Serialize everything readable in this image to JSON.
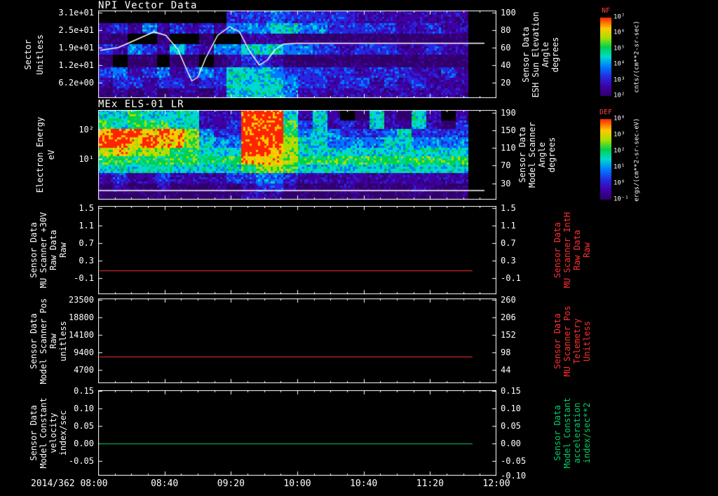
{
  "chart_data": {
    "type": "multi-panel time series (2 spectrograms + 3 line plots)",
    "time_axis": {
      "date": "2014/362",
      "start": "08:00",
      "end": "12:00",
      "start_label": "2014/362 08:00",
      "tick_labels": [
        "08:40",
        "09:20",
        "10:00",
        "10:40",
        "11:20",
        "12:00"
      ]
    },
    "intensity_scale": "grid values 0-9 mapped to rainbow colormap (0=black, 2=purple-blue, 5=cyan, 6=green, 9=red)",
    "panels": [
      {
        "type": "spectrogram",
        "title": "NPI Vector Data",
        "left_title": [
          "Sector",
          "Unitless"
        ],
        "left_ticks": [
          "3.1e+01",
          "2.5e+01",
          "1.9e+01",
          "1.2e+01",
          "6.2e+00"
        ],
        "right_title": [
          "Sensor Data",
          "ESH Sun Elevation",
          "Angle",
          "degrees"
        ],
        "right_ticks": [
          "100",
          "80",
          "60",
          "40",
          "20"
        ],
        "right_color": "#ffffff",
        "y_range": [
          102.4,
          2.4
        ],
        "grid": [
          "0000000003334333332222222200",
          "2324232324445544333332232200",
          "1100100100222111111111111100",
          "3243253244555443323332232200",
          "1011011012332111111111111100",
          "3423423435554333332333223200",
          "2332332335555433233232322200",
          "1212122125555422222222222200"
        ],
        "overlay_line": {
          "color": "#ffffff",
          "x_extent": 0.97,
          "points": [
            [
              0.005,
              57
            ],
            [
              0.05,
              60
            ],
            [
              0.1,
              70
            ],
            [
              0.14,
              78
            ],
            [
              0.17,
              74
            ],
            [
              0.2,
              58
            ],
            [
              0.225,
              32
            ],
            [
              0.235,
              22
            ],
            [
              0.25,
              26
            ],
            [
              0.27,
              48
            ],
            [
              0.3,
              74
            ],
            [
              0.33,
              84
            ],
            [
              0.355,
              78
            ],
            [
              0.38,
              56
            ],
            [
              0.405,
              40
            ],
            [
              0.425,
              46
            ],
            [
              0.445,
              58
            ],
            [
              0.465,
              64
            ],
            [
              0.5,
              65
            ],
            [
              0.97,
              65
            ]
          ]
        }
      },
      {
        "type": "spectrogram",
        "title": "MEx ELS-01 LR",
        "left_title": [
          "Electron Energy",
          "eV"
        ],
        "left_ticks": [
          "10²",
          "10¹"
        ],
        "right_title": [
          "Sensor Data",
          "Model Scanner",
          "Angle",
          "degrees"
        ],
        "right_ticks": [
          "190",
          "150",
          "110",
          "70",
          "30"
        ],
        "right_color": "#ffffff",
        "y_range": [
          196,
          -6.5
        ],
        "grid": [
          "5565555222999525201521520200",
          "6566655223999635232522521300",
          "8998987433999645433345333300",
          "9989887544999755444455444400",
          "7877766555998755555555555500",
          "6666666666888766666666666600",
          "5555555555677655555555555500",
          "2322322223344322222222222200",
          "1211211121233211121111211100",
          "1111111111222111111111111100"
        ],
        "overlay_line": {
          "color": "#ffffff",
          "x_extent": 0.97,
          "points": [
            [
              0.0,
              14
            ],
            [
              0.97,
              14
            ]
          ]
        }
      },
      {
        "type": "line",
        "title": "",
        "left_title": [
          "Sensor Data",
          "MU Scanner +30V",
          "Raw Data",
          "Raw"
        ],
        "left_ticks": [
          "1.5",
          "1.1",
          "0.7",
          "0.3",
          "-0.1"
        ],
        "right_title": [
          "Sensor Data",
          "MU Scanner IntH",
          "Raw Data",
          "Raw"
        ],
        "right_ticks": [
          "1.5",
          "1.1",
          "0.7",
          "0.3",
          "-0.1"
        ],
        "right_color": "#ff3030",
        "y_range": [
          1.54,
          -0.46
        ],
        "line": {
          "value": 0.08,
          "color": "#ff3030",
          "x_extent": 0.94
        }
      },
      {
        "type": "line",
        "title": "",
        "left_title": [
          "Sensor Data",
          "Model Scanner Pos",
          "Raw",
          "unitless"
        ],
        "left_ticks": [
          "23500",
          "18800",
          "14100",
          "9400",
          "4700"
        ],
        "right_title": [
          "Sensor Data",
          "MU Scanner Pos",
          "Telemetry",
          "Unitless"
        ],
        "right_ticks": [
          "260",
          "206",
          "152",
          "98",
          "44"
        ],
        "right_color": "#ff3030",
        "y_range": [
          23959,
          1032
        ],
        "line": {
          "value": 8200,
          "color": "#ff3030",
          "x_extent": 0.94
        }
      },
      {
        "type": "line",
        "title": "",
        "left_title": [
          "Sensor Data",
          "Model Constant",
          "velocity",
          "index/sec"
        ],
        "left_ticks": [
          "0.15",
          "0.10",
          "0.05",
          "0.00",
          "-0.05"
        ],
        "right_title": [
          "Sensor Data",
          "Model Constant",
          "acceleration",
          "index/sec**2"
        ],
        "right_ticks": [
          "0.15",
          "0.10",
          "0.05",
          "0.00",
          "-0.05",
          "-0.10"
        ],
        "right_color": "#00cc66",
        "y_range": [
          0.1524,
          -0.0915
        ],
        "line": {
          "value": 0.0,
          "color": "#00cc66",
          "x_extent": 0.94
        }
      }
    ],
    "colorbars": [
      {
        "title": "NF",
        "ticks": [
          "10⁷",
          "10⁶",
          "10⁵",
          "10⁴",
          "10³",
          "10²"
        ],
        "units": "cnts/(cm**2-sr-sec)"
      },
      {
        "title": "DEF",
        "ticks": [
          "10⁴",
          "10³",
          "10²",
          "10¹",
          "10⁰",
          "10⁻¹"
        ],
        "units": "ergs/(cm**2-sr-sec-eV)"
      }
    ]
  }
}
